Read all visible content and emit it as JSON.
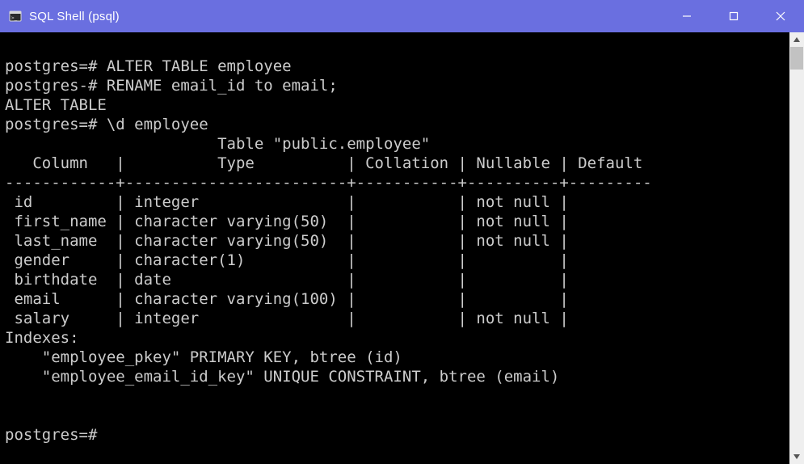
{
  "window": {
    "title": "SQL Shell (psql)"
  },
  "terminal": {
    "lines": [
      "",
      "postgres=# ALTER TABLE employee",
      "postgres-# RENAME email_id to email;",
      "ALTER TABLE",
      "postgres=# \\d employee",
      "                       Table \"public.employee\"",
      "   Column   |          Type          | Collation | Nullable | Default",
      "------------+------------------------+-----------+----------+---------",
      " id         | integer                |           | not null |",
      " first_name | character varying(50)  |           | not null |",
      " last_name  | character varying(50)  |           | not null |",
      " gender     | character(1)           |           |          |",
      " birthdate  | date                   |           |          |",
      " email      | character varying(100) |           |          |",
      " salary     | integer                |           | not null |",
      "Indexes:",
      "    \"employee_pkey\" PRIMARY KEY, btree (id)",
      "    \"employee_email_id_key\" UNIQUE CONSTRAINT, btree (email)",
      "",
      "",
      "postgres=#"
    ]
  },
  "table_schema": {
    "name": "public.employee",
    "columns": [
      {
        "name": "id",
        "type": "integer",
        "collation": "",
        "nullable": "not null",
        "default": ""
      },
      {
        "name": "first_name",
        "type": "character varying(50)",
        "collation": "",
        "nullable": "not null",
        "default": ""
      },
      {
        "name": "last_name",
        "type": "character varying(50)",
        "collation": "",
        "nullable": "not null",
        "default": ""
      },
      {
        "name": "gender",
        "type": "character(1)",
        "collation": "",
        "nullable": "",
        "default": ""
      },
      {
        "name": "birthdate",
        "type": "date",
        "collation": "",
        "nullable": "",
        "default": ""
      },
      {
        "name": "email",
        "type": "character varying(100)",
        "collation": "",
        "nullable": "",
        "default": ""
      },
      {
        "name": "salary",
        "type": "integer",
        "collation": "",
        "nullable": "not null",
        "default": ""
      }
    ],
    "indexes": [
      "\"employee_pkey\" PRIMARY KEY, btree (id)",
      "\"employee_email_id_key\" UNIQUE CONSTRAINT, btree (email)"
    ]
  }
}
